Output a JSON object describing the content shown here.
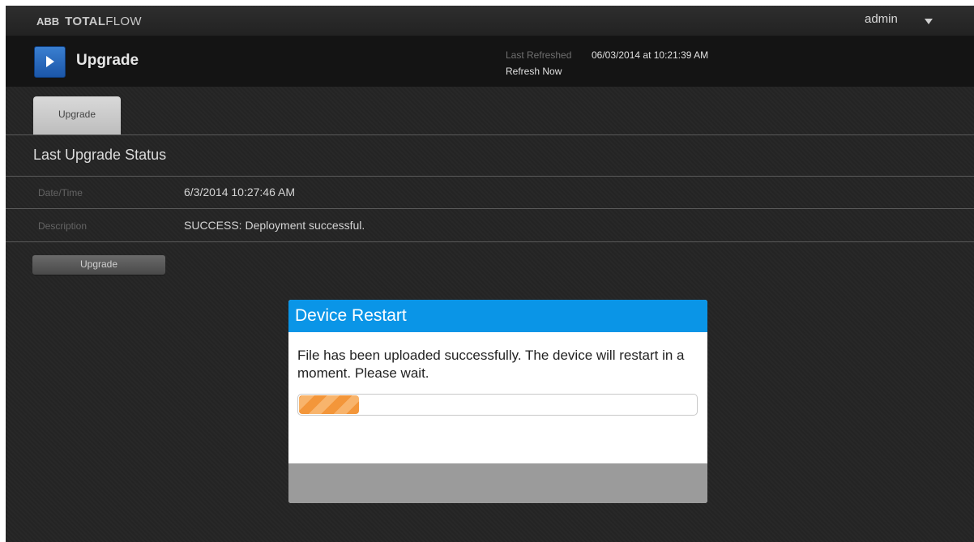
{
  "app": {
    "brand_abb": "ABB",
    "brand_total": "TOTAL",
    "brand_flow": "FLOW",
    "user": "admin"
  },
  "header": {
    "title": "Upgrade",
    "last_refreshed_label": "Last Refreshed",
    "last_refreshed_value": "06/03/2014 at 10:21:39 AM",
    "refresh_now": "Refresh Now"
  },
  "tabs": [
    {
      "label": "Upgrade",
      "active": true
    }
  ],
  "status": {
    "title": "Last Upgrade Status",
    "rows": [
      {
        "label": "Date/Time",
        "value": "6/3/2014 10:27:46 AM"
      },
      {
        "label": "Description",
        "value": "SUCCESS: Deployment successful."
      }
    ],
    "upgrade_button": "Upgrade"
  },
  "modal": {
    "title": "Device Restart",
    "message": "File has been uploaded successfully. The device will restart in a moment. Please wait.",
    "progress_fraction": 0.15
  },
  "colors": {
    "accent_blue": "#0a95e7",
    "progress_orange": "#f3963a",
    "background_dark": "#252525"
  },
  "icons": {
    "header_button": "play-icon",
    "user_menu": "caret-down-icon"
  }
}
